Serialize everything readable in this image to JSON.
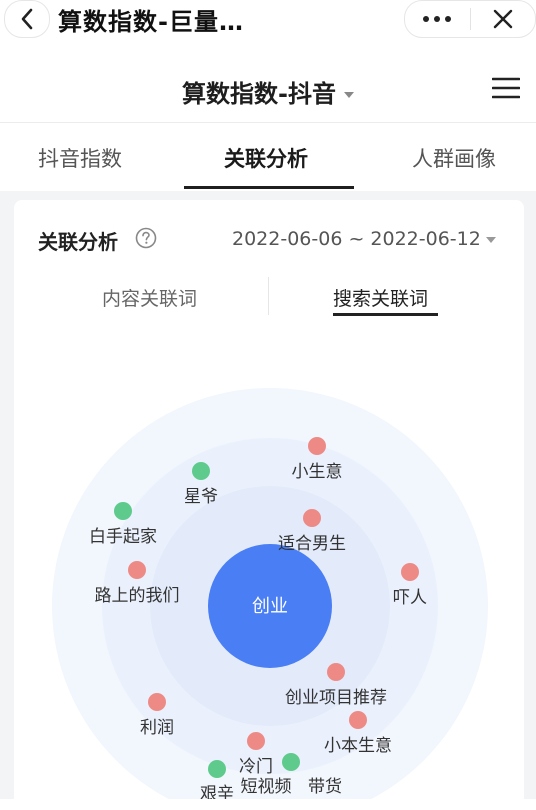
{
  "window": {
    "title": "算数指数-巨量…"
  },
  "header": {
    "title": "算数指数-抖音"
  },
  "tabs": [
    {
      "label": "抖音指数",
      "active": false
    },
    {
      "label": "关联分析",
      "active": true
    },
    {
      "label": "人群画像",
      "active": false
    }
  ],
  "section": {
    "title": "关联分析",
    "date_range": "2022-06-06 ~ 2022-06-12"
  },
  "subtabs": [
    {
      "label": "内容关联词",
      "active": false
    },
    {
      "label": "搜索关联词",
      "active": true
    }
  ],
  "graph": {
    "center_keyword": "创业",
    "colors": {
      "center": "#4a7ef5",
      "red": "#ee8a86",
      "green": "#5ecb8d",
      "ring_outer": "#f2f6fd",
      "ring_mid": "#ebf1fc",
      "ring_inner": "#e3ebfb"
    },
    "keywords": [
      {
        "label": "小生意",
        "color": "red"
      },
      {
        "label": "星爷",
        "color": "green"
      },
      {
        "label": "白手起家",
        "color": "green"
      },
      {
        "label": "适合男生",
        "color": "red"
      },
      {
        "label": "路上的我们",
        "color": "red"
      },
      {
        "label": "吓人",
        "color": "red"
      },
      {
        "label": "创业项目推荐",
        "color": "red"
      },
      {
        "label": "利润",
        "color": "red"
      },
      {
        "label": "小本生意",
        "color": "red"
      },
      {
        "label": "冷门",
        "color": "red"
      },
      {
        "label": "短视频",
        "color": "green"
      },
      {
        "label": "带货",
        "color": "green"
      },
      {
        "label": "艰辛",
        "color": "green"
      }
    ]
  },
  "icons": {
    "back": "chevron-left-icon",
    "more": "more-dots-icon",
    "close": "close-icon",
    "menu": "hamburger-menu-icon",
    "help": "question-circle-icon"
  }
}
